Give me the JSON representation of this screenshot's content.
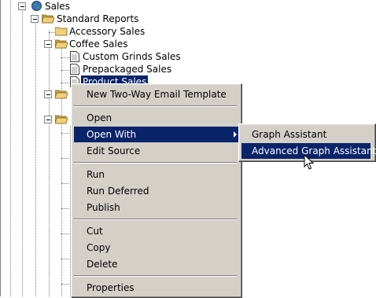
{
  "tree": {
    "root": {
      "label": "Sales",
      "icon": "globe-icon"
    },
    "standard_reports": {
      "label": "Standard Reports"
    },
    "accessory_sales": {
      "label": "Accessory Sales"
    },
    "coffee_sales": {
      "label": "Coffee Sales"
    },
    "custom_grinds": {
      "label": "Custom Grinds Sales"
    },
    "prepackaged": {
      "label": "Prepackaged Sales"
    },
    "product_sales": {
      "label": "Product Sales"
    }
  },
  "context_menu": {
    "new_two_way_email": "New Two-Way Email Template",
    "open": "Open",
    "open_with": "Open With",
    "edit_source": "Edit Source",
    "run": "Run",
    "run_deferred": "Run Deferred",
    "publish": "Publish",
    "cut": "Cut",
    "copy": "Copy",
    "delete": "Delete",
    "properties": "Properties"
  },
  "submenu": {
    "graph_assistant": "Graph Assistant",
    "advanced_graph_assistant": "Advanced Graph Assistant"
  },
  "colors": {
    "selection": "#0a246a",
    "menu_bg": "#d4d0c8",
    "folder": "#f0d078"
  }
}
